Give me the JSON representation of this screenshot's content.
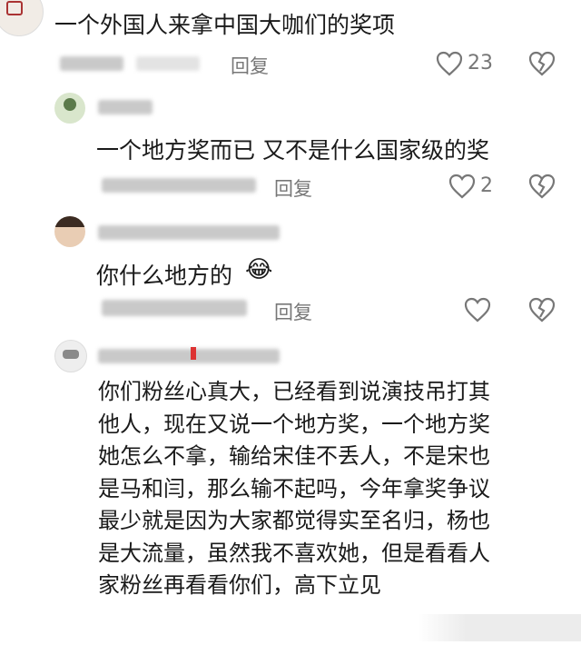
{
  "comments": [
    {
      "text": "一个外国人来拿中国大咖们的奖项",
      "reply_label": "回复",
      "like_count": "23"
    },
    {
      "text": "一个地方奖而已 又不是什么国家级的奖",
      "reply_label": "回复",
      "like_count": "2"
    },
    {
      "text": "你什么地方的",
      "emoji": "😂",
      "reply_label": "回复",
      "like_count": ""
    },
    {
      "lines": [
        "你们粉丝心真大，已经看到说演技吊打其",
        "他人，现在又说一个地方奖，一个地方奖",
        "她怎么不拿，输给宋佳不丢人，不是宋也",
        "是马和闫，那么输不起吗，今年拿奖争议",
        "最少就是因为大家都觉得实至名归，杨也",
        "是大流量，虽然我不喜欢她，但是看看人",
        "家粉丝再看看你们，高下立见"
      ]
    }
  ],
  "icons": {
    "like": "heart-outline-icon",
    "dislike": "broken-heart-icon"
  },
  "colors": {
    "text": "#1a1a1a",
    "meta": "#777777"
  }
}
